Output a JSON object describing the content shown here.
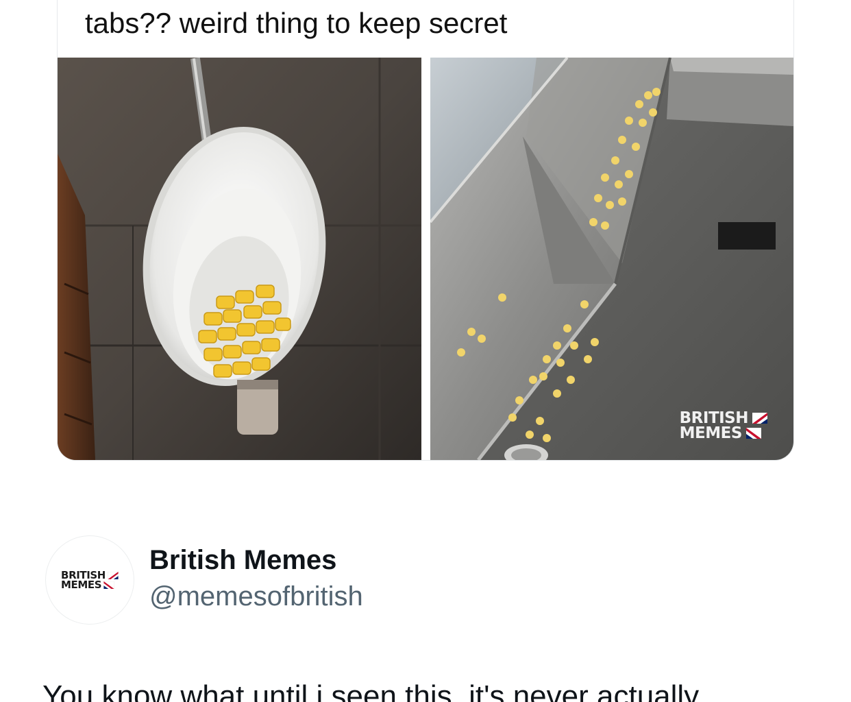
{
  "quoted_tweet": {
    "text": "tabs?? weird thing to keep secret",
    "images": [
      {
        "name": "urinal-with-yellow-tabs"
      },
      {
        "name": "trough-urinal-with-yellow-tabs"
      }
    ],
    "watermark": {
      "line1": "BRITISH",
      "line2": "MEMES"
    }
  },
  "author": {
    "display_name": "British Memes",
    "handle": "@memesofbritish",
    "avatar": {
      "line1": "BRITISH",
      "line2": "MEMES"
    }
  },
  "tweet": {
    "text": "You know what until i seen this, it's never actually"
  },
  "colors": {
    "text_primary": "#0f1419",
    "text_secondary": "#536471",
    "card_border": "#e6e9eb",
    "tab_yellow": "#f2c530"
  }
}
